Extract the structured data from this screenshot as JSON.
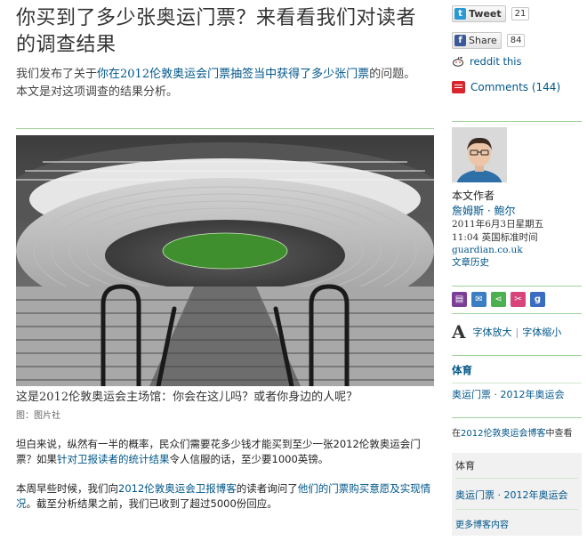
{
  "headline": "你买到了多少张奥运门票？来看看我们对读者的调查结果",
  "standfirst": {
    "before": "我们发布了关于",
    "link": "你在2012伦敦奥运会门票抽签当中获得了多少张门票",
    "after": "的问题。本文是对这项调查的结果分析。"
  },
  "photo": {
    "caption": "这是2012伦敦奥运会主场馆：你会在这儿吗？或者你身边的人呢？",
    "credit": "图：图片社"
  },
  "body": {
    "p1_a": "坦白来说，纵然有一半的概率，民众们需要花多少钱才能买到至少一张2012伦敦奥运会门票？如果",
    "p1_link": "针对卫报读者的统计结果",
    "p1_b": "令人信服的话，至少要1000英镑。",
    "p2_a": "本周早些时候，我们向",
    "p2_link1": "2012伦敦奥运会卫报博客",
    "p2_b": "的读者询问了",
    "p2_link2": "他们的门票购买意愿及实现情况",
    "p2_c": "。截至分析结果之前，我们已收到了超过5000份回应。"
  },
  "share": {
    "tweet_label": "Tweet",
    "tweet_count": "21",
    "facebook_label": "Share",
    "facebook_count": "84",
    "reddit_label": "reddit this",
    "comments_label": "Comments (144)"
  },
  "author": {
    "heading": "本文作者",
    "name": "詹姆斯 · 鲍尔",
    "date": "2011年6月3日星期五",
    "time": "11:04 英国标准时间",
    "source": "guardian.co.uk",
    "history": "文章历史"
  },
  "tools": {
    "icons": [
      "print-icon",
      "email-icon",
      "share-icon",
      "clip-icon",
      "google-icon"
    ],
    "font_larger": "字体放大",
    "separator": "|",
    "font_smaller": "字体缩小",
    "big_a": "A"
  },
  "sections": {
    "sport_heading": "体育",
    "sport_link": "奥运门票 · 2012年奥运会",
    "blog_note_prefix": "在",
    "blog_note_link": "2012伦敦奥运会博客",
    "blog_note_suffix": "中查看",
    "sport_heading_2": "体育",
    "sport_link_2": "奥运门票 · 2012年奥运会",
    "more_blogs": "更多博客内容"
  },
  "colors": {
    "link": "#005689",
    "rule": "#9fd39a",
    "twitter": "#2a9ad6",
    "facebook": "#3b5998",
    "comments": "#d8262c"
  }
}
